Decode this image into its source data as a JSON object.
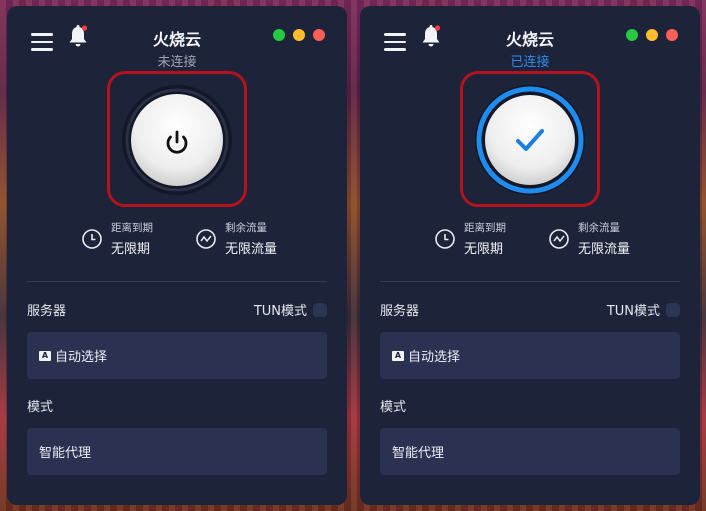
{
  "panels": [
    {
      "title": "火烧云",
      "status": "未连接",
      "status_color": "#9ea3b4",
      "connected": false,
      "expiry_label": "距离到期",
      "expiry_value": "无限期",
      "traffic_label": "剩余流量",
      "traffic_value": "无限流量",
      "server_label": "服务器",
      "tun_label": "TUN模式",
      "server_badge": "A",
      "server_value": "自动选择",
      "mode_label": "模式",
      "mode_value": "智能代理"
    },
    {
      "title": "火烧云",
      "status": "已连接",
      "status_color": "#2f8cf0",
      "connected": true,
      "expiry_label": "距离到期",
      "expiry_value": "无限期",
      "traffic_label": "剩余流量",
      "traffic_value": "无限流量",
      "server_label": "服务器",
      "tun_label": "TUN模式",
      "server_badge": "A",
      "server_value": "自动选择",
      "mode_label": "模式",
      "mode_value": "智能代理"
    }
  ],
  "colors": {
    "panel_bg": "#1d2338",
    "field_bg": "#2b3150",
    "highlight_frame": "#b4121c",
    "window_green": "#27c93f",
    "window_yellow": "#ffbd2e",
    "window_red": "#ff5f56",
    "connected_ring": "#1e8df0",
    "check": "#1e7fe0"
  },
  "icons": {
    "menu": "hamburger-menu-icon",
    "bell": "bell-icon",
    "power": "power-icon",
    "check": "checkmark-icon",
    "clock": "clock-icon",
    "traffic": "traffic-drop-icon"
  }
}
